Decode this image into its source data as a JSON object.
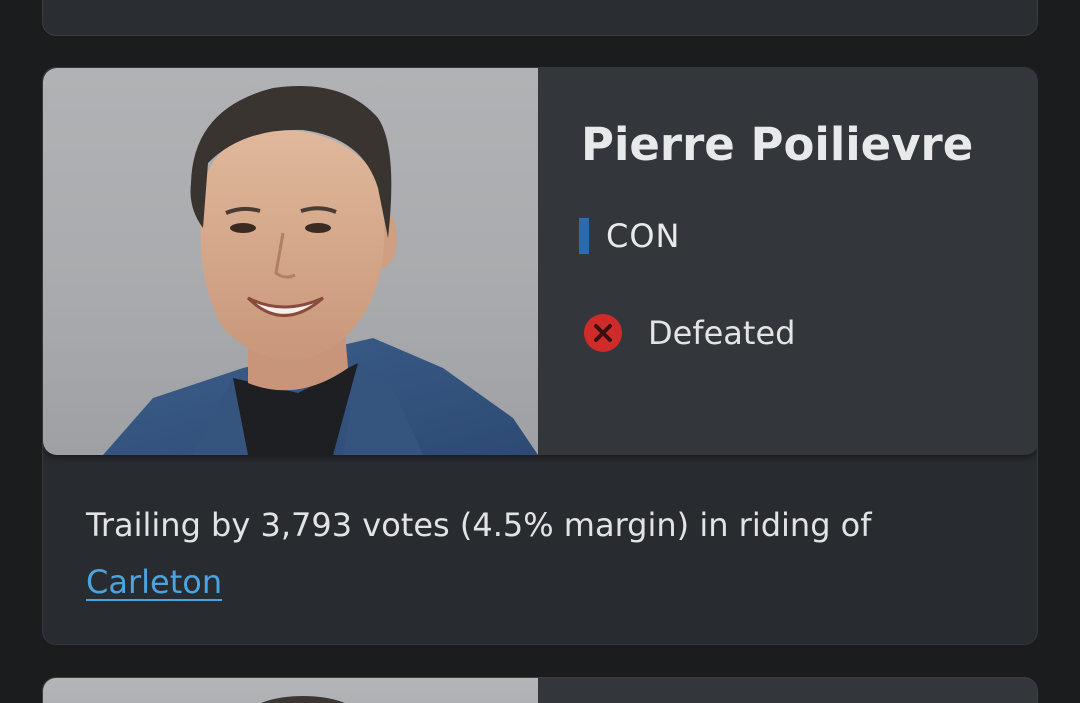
{
  "candidate": {
    "name": "Pierre Poilievre",
    "party": "CON",
    "party_color": "#2b6cb0",
    "status": "Defeated",
    "status_icon": "x-circle-icon",
    "status_color": "#d02b2b"
  },
  "summary": {
    "text": "Trailing by 3,793 votes (4.5% margin) in riding of",
    "riding": "Carleton"
  }
}
